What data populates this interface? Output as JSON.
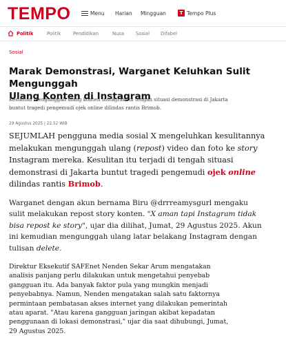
{
  "brand": {
    "logo": "TEMPO",
    "accent": "#d0021b"
  },
  "header": {
    "menu_label": "Menu",
    "harian_label": "Harian",
    "mingguan_label": "Mingguan",
    "tempo_plus_badge": "T",
    "tempo_plus_label": "Tempo Plus",
    "icons": [
      "hamburger-icon",
      "home-icon"
    ]
  },
  "subnav": {
    "items": [
      {
        "label": "Politik",
        "active": true
      },
      {
        "label": "Politik",
        "active": false
      },
      {
        "label": "Pendidikan",
        "active": false
      },
      {
        "label": "Nusa",
        "active": false
      },
      {
        "label": "Sosial",
        "active": false
      },
      {
        "label": "Difabel",
        "active": false
      }
    ]
  },
  "article": {
    "category": "Sosial",
    "headline": "Marak Demonstrasi, Warganet Keluhkan Sulit Mengunggah\nUlang Konten di Instagram",
    "dek": "Kesulitan mengunggah ulang konten Instagram di tengah situasi demonstrasi di Jakarta\nbuntut tragedi pengemudi ojek online dilindas rantis Brimob.",
    "date": "29 Agustus 2025 | 22.52 WIB",
    "p1": {
      "l1": "SEJUMLAH pengguna media sosial X mengeluhkan kesulitannya",
      "l2a": "melakukan mengunggah ulang (",
      "l2b": "repost",
      "l2c": ") video dan foto ke ",
      "l2d": "story",
      "l3": "Instagram mereka. Kesulitan itu terjadi di tengah situasi",
      "l4a": "demonstrasi di Jakarta buntut tragedi pengemudi ",
      "l4b": "ojek",
      "l4c": "online",
      "l5a": "dilindas rantis ",
      "l5b": "Brimob",
      "l5c": "."
    },
    "p2": {
      "l1": "Warganet dengan akun bernama Biru @drrreamysgurl mengaku",
      "l2a": "sulit melakukan repost story konten. \"",
      "l2b": "X aman tapi Instagram tidak",
      "l3a": "bisa repost ke story",
      "l3b": "\", ujar dia dilihat, Jumat, 29 Agustus 2025. Akun",
      "l4": "ini kemudian mengunggah ulang latar belakang Instagram dengan",
      "l5a": "tulisan ",
      "l5b": "delete",
      "l5c": "."
    },
    "p3": {
      "l1": "Direktur Eksekutif SAFEnet Nenden Sekar Arum mengatakan",
      "l2": "analisis panjang perlu dilakukan untuk mengetahui penyebab",
      "l3": "gangguan itu. Ada banyak faktor pula yang mungkin menjadi",
      "l4": "penyebabnya. Namun, Nenden mengatakan salah satu faktornya",
      "l5": "permintaan pembatasan akses internet yang dilakukan pemerintah",
      "l6": "atau aparat. \"Atau karena gangguan jaringan akibat kepadatan",
      "l7": "penggunaan di lokasi demonstrasi,\" ujar dia saat dihubungi, Jumat,",
      "l8": "29 Agustus 2025."
    }
  }
}
